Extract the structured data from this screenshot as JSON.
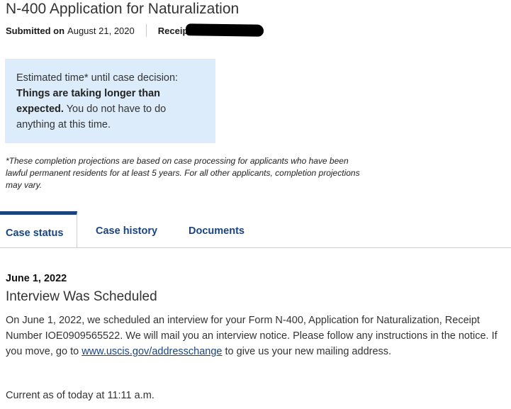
{
  "header": {
    "title": "N-400 Application for Naturalization",
    "submitted_label": "Submitted on",
    "submitted_date": "August 21, 2020",
    "receipt_label": "Receipt"
  },
  "estimate": {
    "intro": "Estimated time* until case decision:",
    "headline": "Things are taking longer than expected.",
    "body": "You do not have to do anything at this time."
  },
  "footnote": "*These completion projections are based on case processing for applicants who have been lawful permanent residents for at least 5 years. For all other applicants, completion projections may vary.",
  "tabs": [
    {
      "label": "Case status",
      "active": true
    },
    {
      "label": "Case history",
      "active": false
    },
    {
      "label": "Documents",
      "active": false
    }
  ],
  "event": {
    "date": "June 1, 2022",
    "title": "Interview Was Scheduled",
    "body_before_link": "On June 1, 2022, we scheduled an interview for your Form N-400, Application for Naturalization, Receipt Number IOE0909565522. We will mail you an interview notice. Please follow any instructions in the notice. If you move, go to",
    "link_text": "www.uscis.gov/addresschange",
    "body_after_link": "to give us your new mailing address."
  },
  "current_as_of": "Current as of today at 11:11 a.m.",
  "colors": {
    "link": "#1a4480",
    "estimate_background": "#dcecfa",
    "active_tab_border": "#1a4480"
  }
}
